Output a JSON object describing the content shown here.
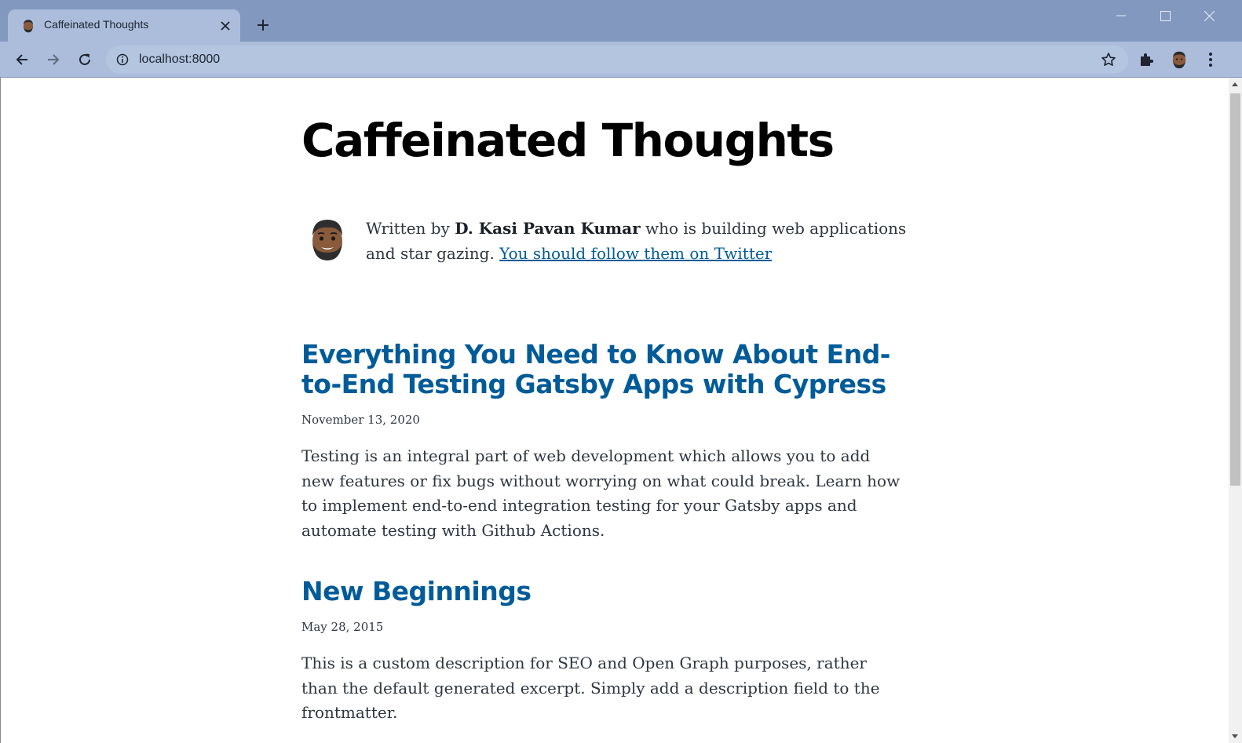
{
  "browser": {
    "tab_title": "Caffeinated Thoughts",
    "url": "localhost:8000",
    "colors": {
      "frame": "#8298bf",
      "toolbar": "#abbddb",
      "omnibox": "#b4c5e0"
    }
  },
  "page": {
    "site_title": "Caffeinated Thoughts",
    "bio": {
      "prefix": "Written by ",
      "author": "D. Kasi Pavan Kumar",
      "middle": " who is building web applications and star gazing. ",
      "link_text": "You should follow them on Twitter"
    },
    "posts": [
      {
        "title": "Everything You Need to Know About End-to-End Testing Gatsby Apps with Cypress",
        "date": "November 13, 2020",
        "description": "Testing is an integral part of web development which allows you to add new features or fix bugs without worrying on what could break. Learn how to implement end-to-end integration testing for your Gatsby apps and automate testing with Github Actions."
      },
      {
        "title": "New Beginnings",
        "date": "May 28, 2015",
        "description": "This is a custom description for SEO and Open Graph purposes, rather than the default generated excerpt. Simply add a description field to the frontmatter."
      }
    ],
    "colors": {
      "link": "#005b99",
      "text": "#2e353f",
      "heading": "#000000"
    }
  },
  "icons": {
    "favicon": "bearded-face-emoji-icon",
    "tab_close": "close-icon",
    "new_tab": "plus-icon",
    "back": "arrow-left-icon",
    "forward": "arrow-right-icon",
    "reload": "reload-icon",
    "site_info": "info-icon",
    "bookmark": "star-icon",
    "extensions": "puzzle-icon",
    "profile": "avatar-icon",
    "menu": "kebab-menu-icon"
  }
}
